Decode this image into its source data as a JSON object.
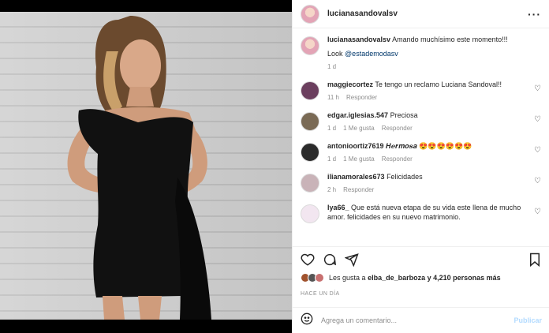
{
  "post": {
    "author": "lucianasandovalsv",
    "caption_text": "Amando muchísimo este momento!!!",
    "caption_look_prefix": "Look",
    "caption_mention": "@estademodasv",
    "caption_age": "1 d"
  },
  "comments": [
    {
      "user": "maggiecortez",
      "text": "Te tengo un reclamo Luciana Sandoval!!",
      "age": "11 h",
      "likes": "",
      "reply": "Responder",
      "avatar_color": "#6b3f5e"
    },
    {
      "user": "edgar.iglesias.547",
      "text": "Preciosa",
      "age": "1 d",
      "likes": "1 Me gusta",
      "reply": "Responder",
      "avatar_color": "#7a6a55"
    },
    {
      "user": "antonioortiz7619",
      "text": "𝑯𝒆𝒓𝒎𝒐𝒔𝒂 😍😍😍😍😍😍",
      "age": "1 d",
      "likes": "1 Me gusta",
      "reply": "Responder",
      "avatar_color": "#2b2b2b"
    },
    {
      "user": "ilianamorales673",
      "text": "Felicidades",
      "age": "2 h",
      "likes": "",
      "reply": "Responder",
      "avatar_color": "#c9b3b8"
    },
    {
      "user": "lya66_",
      "text": "Que está nueva etapa de su vida este llena de mucho amor. felicidades en su nuevo matrimonio.",
      "age": "",
      "likes": "",
      "reply": "",
      "avatar_color": "#f2e6f0"
    }
  ],
  "likes": {
    "prefix": "Les gusta a",
    "user": "elba_de_barboza",
    "suffix": "y 4,210 personas más"
  },
  "timestamp": "HACE UN DÍA",
  "add_comment": {
    "placeholder": "Agrega un comentario...",
    "post_label": "Publicar"
  },
  "icons": {
    "more": "more-options-icon",
    "heart": "heart-icon",
    "comment": "comment-icon",
    "share": "share-icon",
    "save": "bookmark-icon",
    "emoji": "emoji-icon"
  },
  "colors": {
    "link": "#00376b",
    "muted": "#8e8e8e",
    "publish": "#b3dbff"
  }
}
